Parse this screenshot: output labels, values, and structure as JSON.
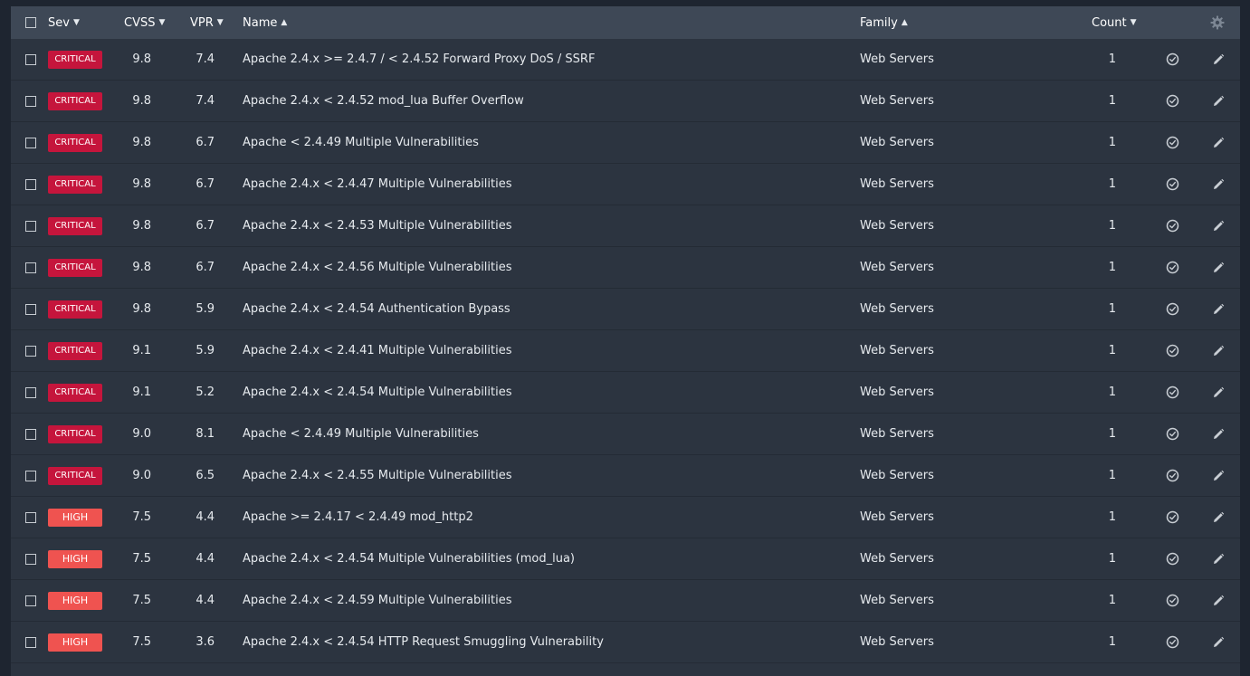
{
  "header": {
    "sev": "Sev",
    "cvss": "CVSS",
    "vpr": "VPR",
    "name": "Name",
    "family": "Family",
    "count": "Count",
    "sort_down": "▼",
    "sort_up": "▲"
  },
  "icons": {
    "gear": "gear-icon",
    "snooze": "snooze-clock-icon",
    "edit": "pencil-icon"
  },
  "colors": {
    "critical": "#c5153c",
    "high": "#ef5350",
    "header_bg": "#3e4856",
    "row_bg": "#2c3440"
  },
  "rows": [
    {
      "sev": "CRITICAL",
      "level": "critical",
      "cvss": "9.8",
      "vpr": "7.4",
      "name": "Apache 2.4.x >= 2.4.7 / < 2.4.52 Forward Proxy DoS / SSRF",
      "family": "Web Servers",
      "count": "1"
    },
    {
      "sev": "CRITICAL",
      "level": "critical",
      "cvss": "9.8",
      "vpr": "7.4",
      "name": "Apache 2.4.x < 2.4.52 mod_lua Buffer Overflow",
      "family": "Web Servers",
      "count": "1"
    },
    {
      "sev": "CRITICAL",
      "level": "critical",
      "cvss": "9.8",
      "vpr": "6.7",
      "name": "Apache < 2.4.49 Multiple Vulnerabilities",
      "family": "Web Servers",
      "count": "1"
    },
    {
      "sev": "CRITICAL",
      "level": "critical",
      "cvss": "9.8",
      "vpr": "6.7",
      "name": "Apache 2.4.x < 2.4.47 Multiple Vulnerabilities",
      "family": "Web Servers",
      "count": "1"
    },
    {
      "sev": "CRITICAL",
      "level": "critical",
      "cvss": "9.8",
      "vpr": "6.7",
      "name": "Apache 2.4.x < 2.4.53 Multiple Vulnerabilities",
      "family": "Web Servers",
      "count": "1"
    },
    {
      "sev": "CRITICAL",
      "level": "critical",
      "cvss": "9.8",
      "vpr": "6.7",
      "name": "Apache 2.4.x < 2.4.56 Multiple Vulnerabilities",
      "family": "Web Servers",
      "count": "1"
    },
    {
      "sev": "CRITICAL",
      "level": "critical",
      "cvss": "9.8",
      "vpr": "5.9",
      "name": "Apache 2.4.x < 2.4.54 Authentication Bypass",
      "family": "Web Servers",
      "count": "1"
    },
    {
      "sev": "CRITICAL",
      "level": "critical",
      "cvss": "9.1",
      "vpr": "5.9",
      "name": "Apache 2.4.x < 2.4.41 Multiple Vulnerabilities",
      "family": "Web Servers",
      "count": "1"
    },
    {
      "sev": "CRITICAL",
      "level": "critical",
      "cvss": "9.1",
      "vpr": "5.2",
      "name": "Apache 2.4.x < 2.4.54 Multiple Vulnerabilities",
      "family": "Web Servers",
      "count": "1"
    },
    {
      "sev": "CRITICAL",
      "level": "critical",
      "cvss": "9.0",
      "vpr": "8.1",
      "name": "Apache < 2.4.49 Multiple Vulnerabilities",
      "family": "Web Servers",
      "count": "1"
    },
    {
      "sev": "CRITICAL",
      "level": "critical",
      "cvss": "9.0",
      "vpr": "6.5",
      "name": "Apache 2.4.x < 2.4.55 Multiple Vulnerabilities",
      "family": "Web Servers",
      "count": "1"
    },
    {
      "sev": "HIGH",
      "level": "high",
      "cvss": "7.5",
      "vpr": "4.4",
      "name": "Apache >= 2.4.17 < 2.4.49 mod_http2",
      "family": "Web Servers",
      "count": "1"
    },
    {
      "sev": "HIGH",
      "level": "high",
      "cvss": "7.5",
      "vpr": "4.4",
      "name": "Apache 2.4.x < 2.4.54 Multiple Vulnerabilities (mod_lua)",
      "family": "Web Servers",
      "count": "1"
    },
    {
      "sev": "HIGH",
      "level": "high",
      "cvss": "7.5",
      "vpr": "4.4",
      "name": "Apache 2.4.x < 2.4.59 Multiple Vulnerabilities",
      "family": "Web Servers",
      "count": "1"
    },
    {
      "sev": "HIGH",
      "level": "high",
      "cvss": "7.5",
      "vpr": "3.6",
      "name": "Apache 2.4.x < 2.4.54 HTTP Request Smuggling Vulnerability",
      "family": "Web Servers",
      "count": "1"
    }
  ]
}
